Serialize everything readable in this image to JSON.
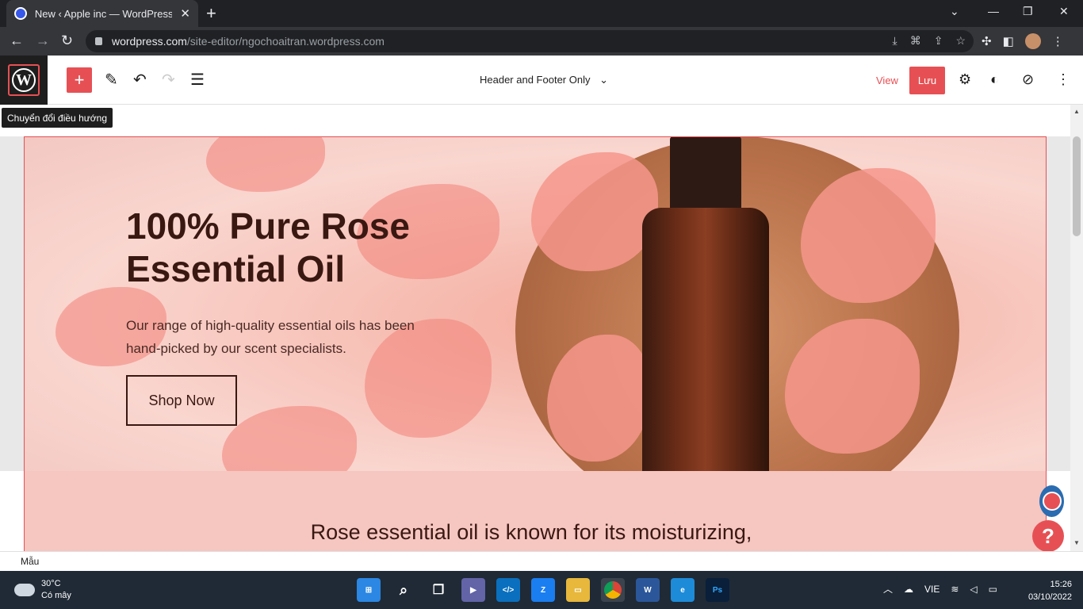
{
  "browser": {
    "tab_title": "New ‹ Apple inc — WordPress.co",
    "url_host": "wordpress.com",
    "url_path": "/site-editor/ngochoaitran.wordpress.com"
  },
  "editor": {
    "template_selector": "Header and Footer Only",
    "view_label": "View",
    "save_label": "Lưu",
    "tooltip": "Chuyển đổi điều hướng",
    "footer_label": "Mẫu"
  },
  "hero": {
    "title": "100% Pure Rose Essential Oil",
    "description": "Our range of high-quality essential oils has been hand-picked by our scent specialists.",
    "button_label": "Shop Now"
  },
  "section2": {
    "text": "Rose essential oil is known for its moisturizing,"
  },
  "taskbar": {
    "temperature": "30°C",
    "weather": "Có mây",
    "language": "VIE",
    "time": "15:26",
    "date": "03/10/2022",
    "apps": [
      "windows-start",
      "search",
      "task-view",
      "teams-chat",
      "vscode",
      "zalo",
      "file-explorer",
      "chrome",
      "word",
      "edge",
      "photoshop"
    ]
  },
  "colors": {
    "accent": "#e65054",
    "wp_dark": "#1e1e1e",
    "hero_text": "#3a1812"
  }
}
